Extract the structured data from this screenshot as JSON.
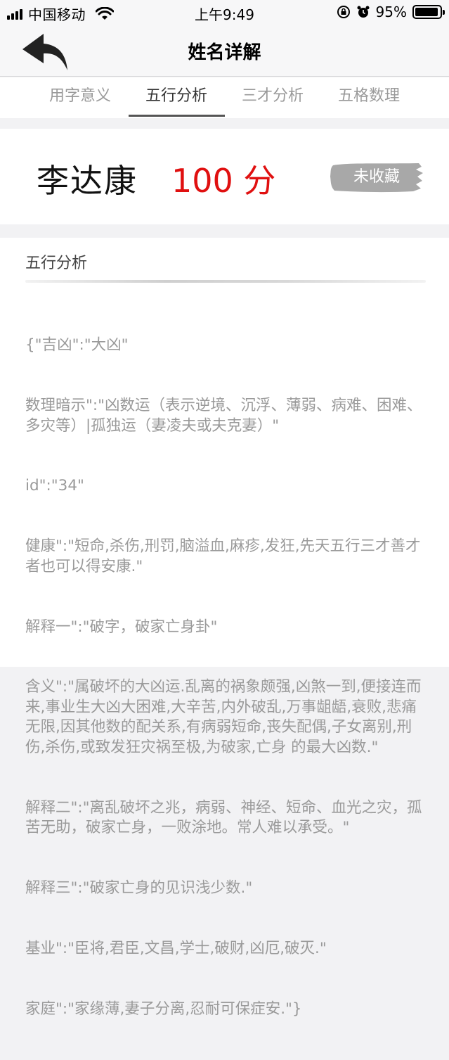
{
  "status_bar": {
    "carrier": "中国移动",
    "time": "上午9:49",
    "battery": "95%",
    "battery_level": 0.95
  },
  "nav": {
    "title": "姓名详解"
  },
  "tabs": [
    {
      "label": "用字意义",
      "active": false
    },
    {
      "label": "五行分析",
      "active": true
    },
    {
      "label": "三才分析",
      "active": false
    },
    {
      "label": "五格数理",
      "active": false
    }
  ],
  "score_card": {
    "name": "李达康",
    "score": "100 分",
    "collect_label": "未收藏"
  },
  "analysis": {
    "title": "五行分析",
    "lines": [
      "{\"吉凶\":\"大凶\"",
      "数理暗示\":\"凶数运（表示逆境、沉浮、薄弱、病难、困难、多灾等）|孤独运（妻凌夫或夫克妻）\"",
      "id\":\"34\"",
      "健康\":\"短命,杀伤,刑罚,脑溢血,麻疹,发狂,先天五行三才善才者也可以得安康.\"",
      "解释一\":\"破字，破家亡身卦\"",
      "含义\":\"属破坏的大凶运.乱离的祸象颇强,凶煞一到,便接连而来,事业生大凶大困难,大辛苦,内外破乱,万事龃龉,衰败,悲痛无限,因其他数的配关系,有病弱短命,丧失配偶,子女离别,刑伤,杀伤,或致发狂灾祸至极,为破家,亡身 的最大凶数.\"",
      "解释二\":\"离乱破坏之兆，病弱、神经、短命、血光之灾，孤苦无助，破家亡身，一败涂地。常人难以承受。\"",
      "解释三\":\"破家亡身的见识浅少数.\"",
      "基业\":\"臣将,君臣,文昌,学士,破财,凶厄,破灭.\"",
      "家庭\":\"家缘薄,妻子分离,忍耐可保症安.\"}"
    ]
  },
  "colors": {
    "score": "#e01010",
    "tab_active": "#333333",
    "tab_inactive": "#9a9a9a",
    "body_text": "#9a9a9a",
    "collect_brush": "#a8a8a8"
  }
}
